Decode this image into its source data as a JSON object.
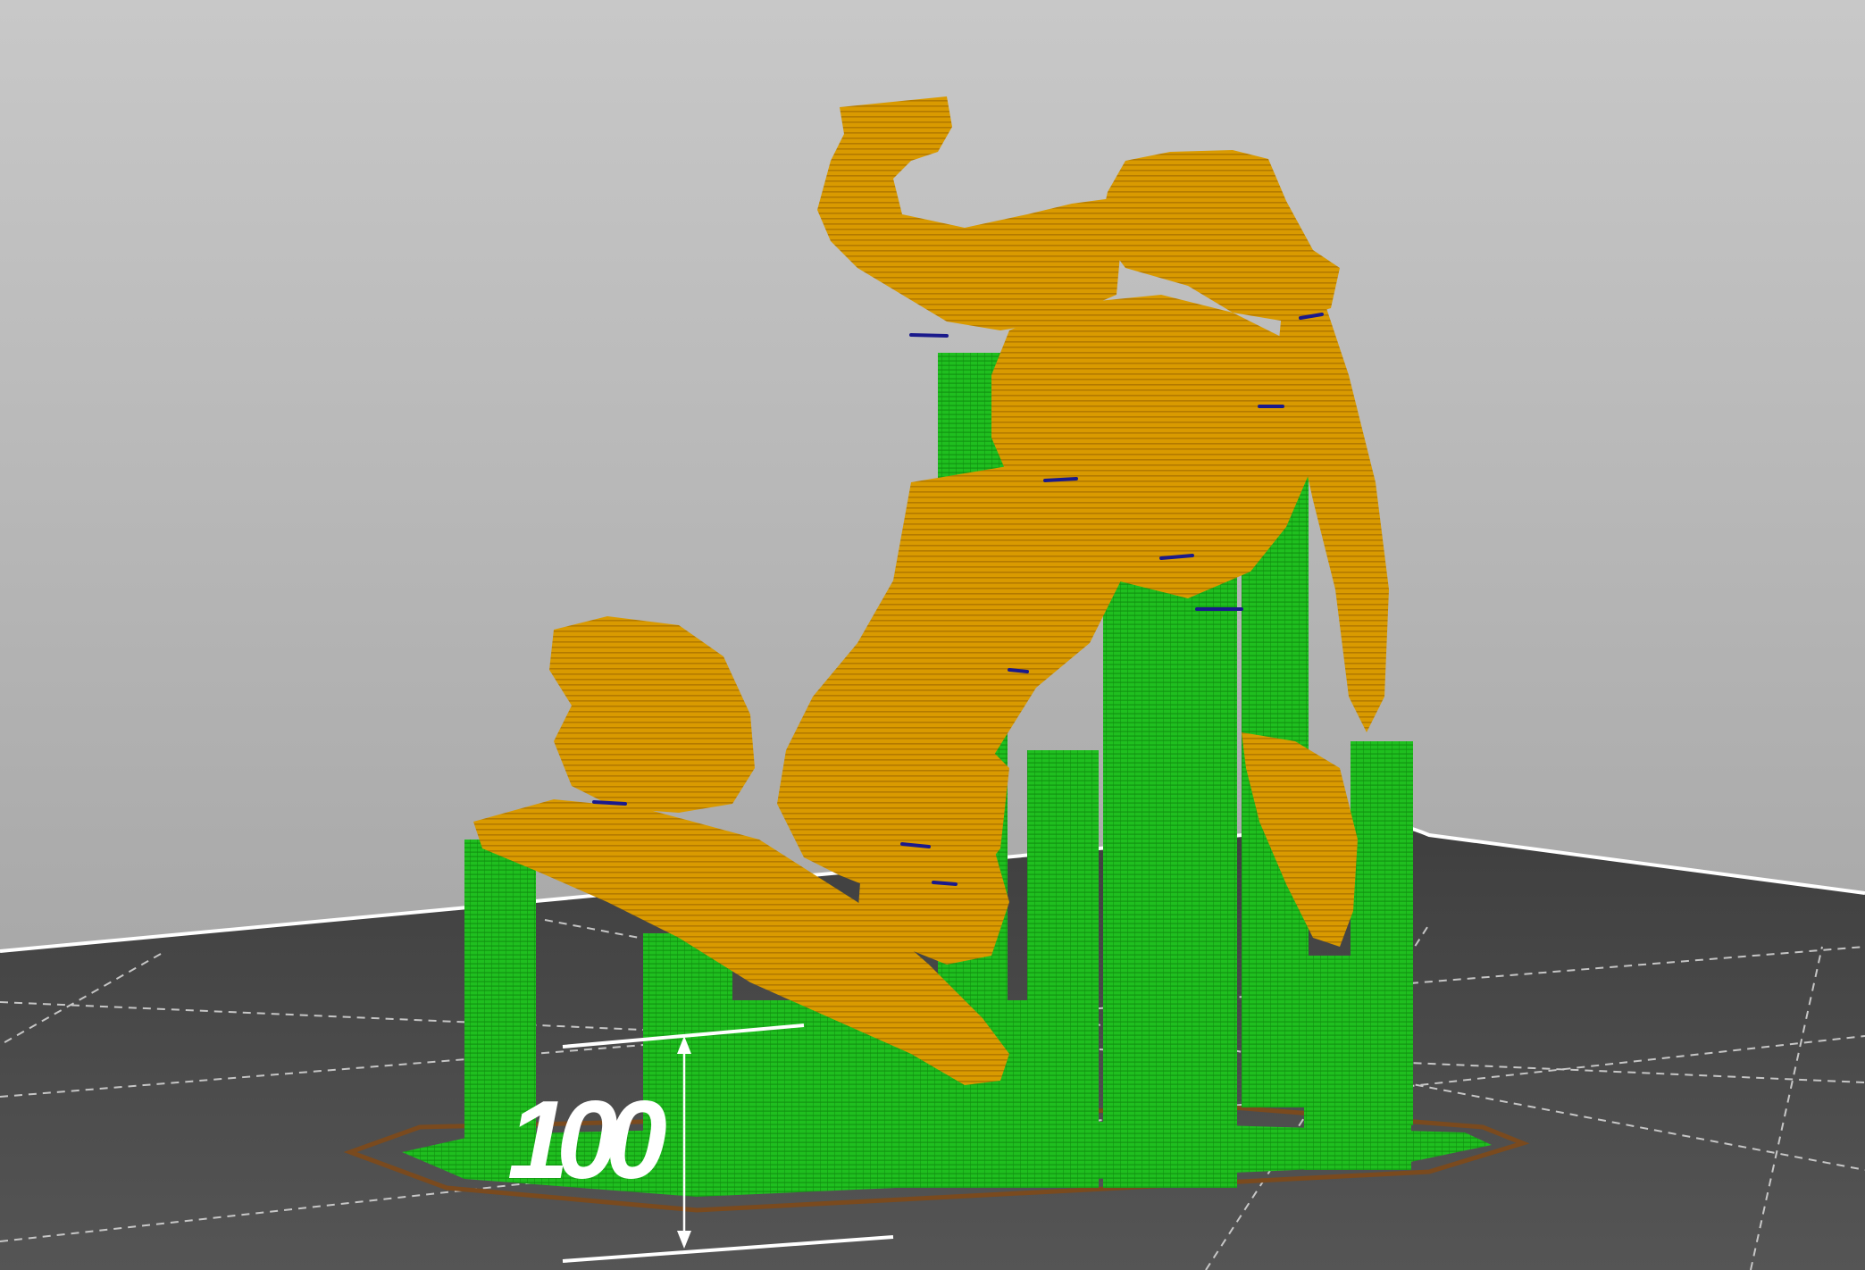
{
  "viewport": {
    "background_top": "#c8c8c8",
    "background_bottom": "#9e9e9e",
    "bed_color": "#4c4c4c",
    "bed_edge_color": "#ffffff",
    "grid_line_color": "#dcdcdc"
  },
  "model": {
    "color": "#d99a00",
    "shade_color": "#a66f00",
    "overhang_mark_color": "#1a1a8c"
  },
  "supports": {
    "color": "#1fbf1f",
    "shade_color": "#0f8a0f"
  },
  "brim": {
    "color": "#7a4a1e"
  },
  "dimension": {
    "value": "100",
    "line_color": "#ffffff"
  }
}
